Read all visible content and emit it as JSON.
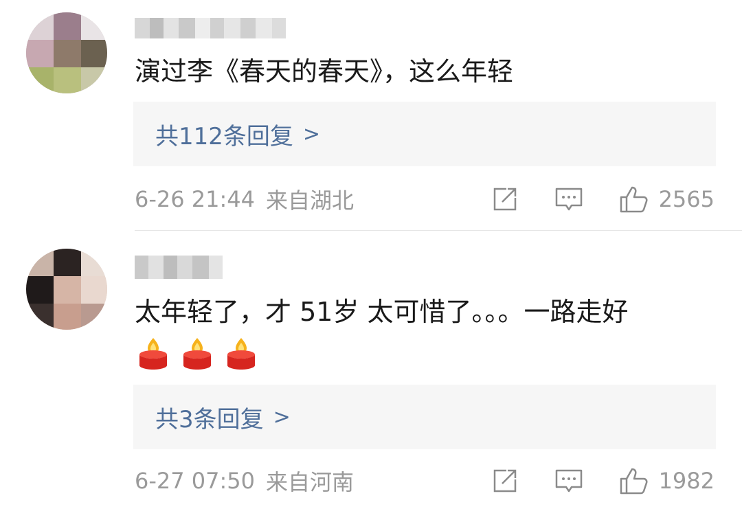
{
  "comments": [
    {
      "text": "演过李《春天的春天》，这么年轻",
      "replies_label": "共112条回复",
      "replies_chevron": ">",
      "time": "6-26 21:44",
      "location": "来自湖北",
      "like_count": "2565",
      "icons": {
        "share": "share-icon",
        "comment": "comment-icon",
        "like": "thumbs-up-icon"
      }
    },
    {
      "text": "太年轻了，才 51岁 太可惜了。。。一路走好",
      "emoji": [
        "candle-emoji",
        "candle-emoji",
        "candle-emoji"
      ],
      "replies_label": "共3条回复",
      "replies_chevron": ">",
      "time": "6-27 07:50",
      "location": "来自河南",
      "like_count": "1982",
      "icons": {
        "share": "share-icon",
        "comment": "comment-icon",
        "like": "thumbs-up-icon"
      }
    }
  ],
  "colors": {
    "reply_link": "#4f6f9a",
    "meta_text": "#9a9a9a",
    "reply_bg": "#f6f6f6"
  }
}
